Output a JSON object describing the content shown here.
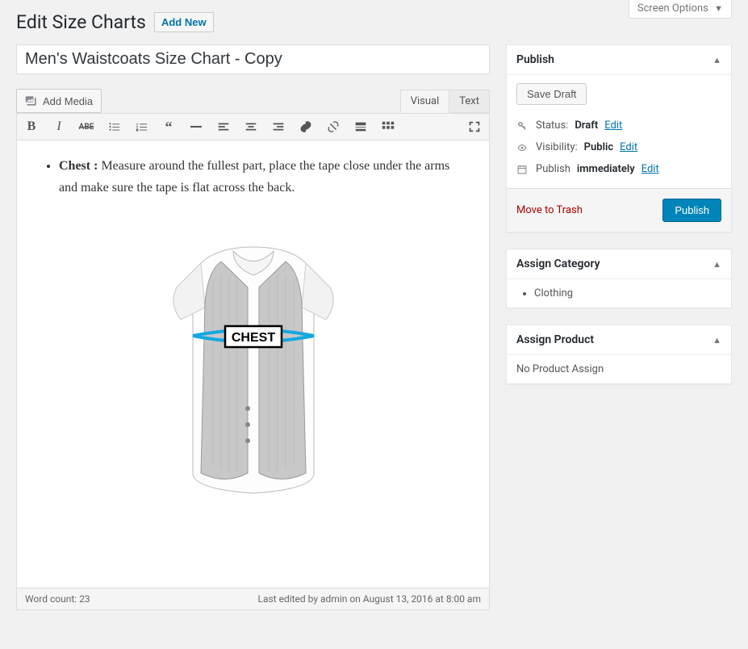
{
  "screen_options": "Screen Options",
  "page_heading": "Edit Size Charts",
  "add_new": "Add New",
  "post_title": "Men's Waistcoats Size Chart - Copy",
  "add_media": "Add Media",
  "editor_tabs": {
    "visual": "Visual",
    "text": "Text"
  },
  "content": {
    "bold_label": "Chest :",
    "paragraph": " Measure around the fullest part, place the tape close under the arms and make sure the tape is flat across the back.",
    "image_label": "CHEST"
  },
  "status_bar": {
    "word_count_label": "Word count: ",
    "word_count": "23",
    "last_edited": "Last edited by admin on August 13, 2016 at 8:00 am"
  },
  "publish": {
    "title": "Publish",
    "save_draft": "Save Draft",
    "status_label": "Status:",
    "status_value": "Draft",
    "visibility_label": "Visibility:",
    "visibility_value": "Public",
    "publish_label": "Publish",
    "publish_value": "immediately",
    "edit": "Edit",
    "trash": "Move to Trash",
    "publish_btn": "Publish"
  },
  "category_box": {
    "title": "Assign Category",
    "items": [
      "Clothing"
    ]
  },
  "product_box": {
    "title": "Assign Product",
    "empty": "No Product Assign"
  }
}
